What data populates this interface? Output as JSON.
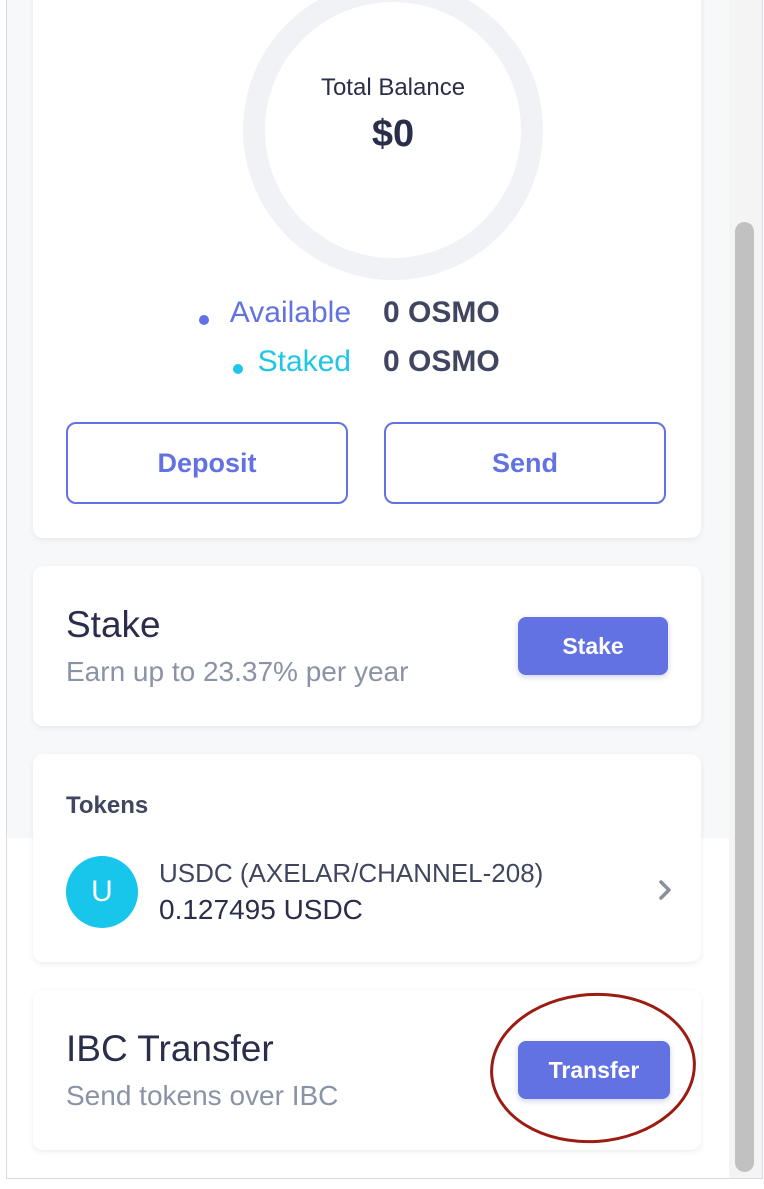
{
  "balance": {
    "label": "Total Balance",
    "value": "$0",
    "available_label": "Available",
    "available_value": "0 OSMO",
    "staked_label": "Staked",
    "staked_value": "0 OSMO",
    "deposit_label": "Deposit",
    "send_label": "Send",
    "available_color": "#6372e2",
    "staked_color": "#1ec6e8"
  },
  "stake": {
    "title": "Stake",
    "subtitle": "Earn up to 23.37% per year",
    "button_label": "Stake"
  },
  "tokens": {
    "heading": "Tokens",
    "items": [
      {
        "avatar_letter": "U",
        "name": "USDC (AXELAR/CHANNEL-208)",
        "amount": "0.127495 USDC",
        "icon": "chevron-right-icon"
      }
    ]
  },
  "ibc": {
    "title": "IBC Transfer",
    "subtitle": "Send tokens over IBC",
    "button_label": "Transfer"
  },
  "colors": {
    "accent": "#6372e2",
    "annotation": "#9c1b12"
  }
}
